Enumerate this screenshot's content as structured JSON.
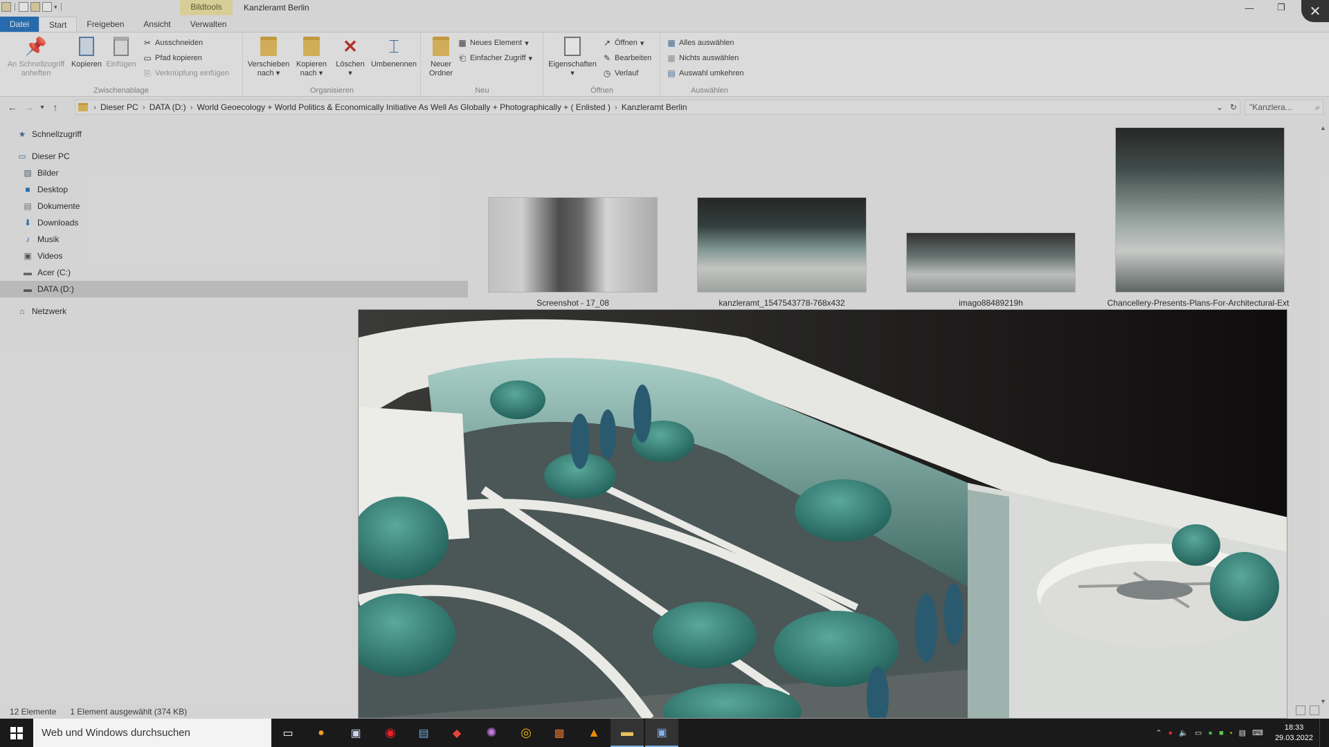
{
  "window": {
    "title": "Kanzleramt Berlin",
    "context_tab": "Bildtools",
    "controls": {
      "minimize": "—",
      "maximize": "❐",
      "close": "✕"
    }
  },
  "ribbon": {
    "tabs": [
      "Datei",
      "Start",
      "Freigeben",
      "Ansicht",
      "Verwalten"
    ],
    "groups": {
      "clipboard": {
        "label": "Zwischenablage",
        "pin": "An Schnellzugriff anheften",
        "copy": "Kopieren",
        "paste": "Einfügen",
        "cut": "Ausschneiden",
        "copy_path": "Pfad kopieren",
        "paste_shortcut": "Verknüpfung einfügen"
      },
      "organize": {
        "label": "Organisieren",
        "move_to": "Verschieben nach",
        "copy_to": "Kopieren nach",
        "delete": "Löschen",
        "rename": "Umbenennen"
      },
      "new": {
        "label": "Neu",
        "new_folder": "Neuer Ordner",
        "new_item": "Neues Element",
        "easy_access": "Einfacher Zugriff"
      },
      "open": {
        "label": "Öffnen",
        "properties": "Eigenschaften",
        "open": "Öffnen",
        "edit": "Bearbeiten",
        "history": "Verlauf"
      },
      "select": {
        "label": "Auswählen",
        "select_all": "Alles auswählen",
        "select_none": "Nichts auswählen",
        "invert": "Auswahl umkehren"
      }
    }
  },
  "address": {
    "crumbs": [
      "Dieser PC",
      "DATA (D:)",
      "World Geoecology + World Politics & Economically Initiative As Well As Globally + Photographically + ( Enlisted )",
      "Kanzleramt Berlin"
    ],
    "search_placeholder": "\"Kanzlera..."
  },
  "sidebar": {
    "quick_access": "Schnellzugriff",
    "this_pc": "Dieser PC",
    "items": [
      "Bilder",
      "Desktop",
      "Dokumente",
      "Downloads",
      "Musik",
      "Videos",
      "Acer (C:)",
      "DATA (D:)"
    ],
    "network": "Netzwerk"
  },
  "files": [
    {
      "name": "Screenshot - 17_08"
    },
    {
      "name": "kanzleramt_1547543778-768x432"
    },
    {
      "name": "imago88489219h"
    },
    {
      "name": "Chancellery-Presents-Plans-For-Architectural-Ext"
    }
  ],
  "status": {
    "count": "12 Elemente",
    "selection": "1 Element ausgewählt (374 KB)"
  },
  "taskbar": {
    "search": "Web und Windows durchsuchen",
    "time": "18:33",
    "date": "29.03.2022"
  },
  "colors": {
    "accent": "#1e6fc0",
    "bildtools": "#f3e7a4",
    "taskbar": "#1a1a1a"
  }
}
